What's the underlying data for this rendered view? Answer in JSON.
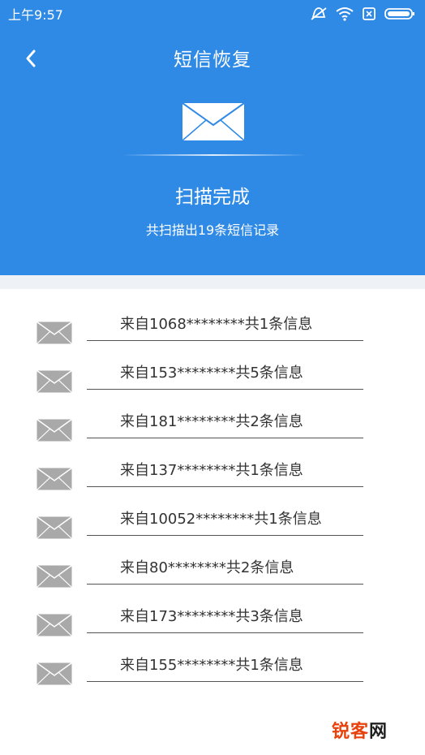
{
  "status_bar": {
    "time": "上午9:57",
    "icons": [
      "mute-icon",
      "wifi-icon",
      "sim-icon",
      "battery-icon"
    ]
  },
  "header": {
    "back_icon": "chevron-left-icon",
    "title": "短信恢复",
    "envelope_icon": "envelope-icon",
    "scan_title": "扫描完成",
    "scan_summary": "共扫描出19条短信记录",
    "background": "#2f8ae6"
  },
  "messages": [
    {
      "label": "来自1068********共1条信息"
    },
    {
      "label": "来自153********共5条信息"
    },
    {
      "label": "来自181********共2条信息"
    },
    {
      "label": "来自137********共1条信息"
    },
    {
      "label": "来自10052********共1条信息"
    },
    {
      "label": "来自80********共2条信息"
    },
    {
      "label": "来自173********共3条信息"
    },
    {
      "label": "来自155********共1条信息"
    }
  ],
  "watermark": {
    "part1": "锐客",
    "part2": "网"
  }
}
